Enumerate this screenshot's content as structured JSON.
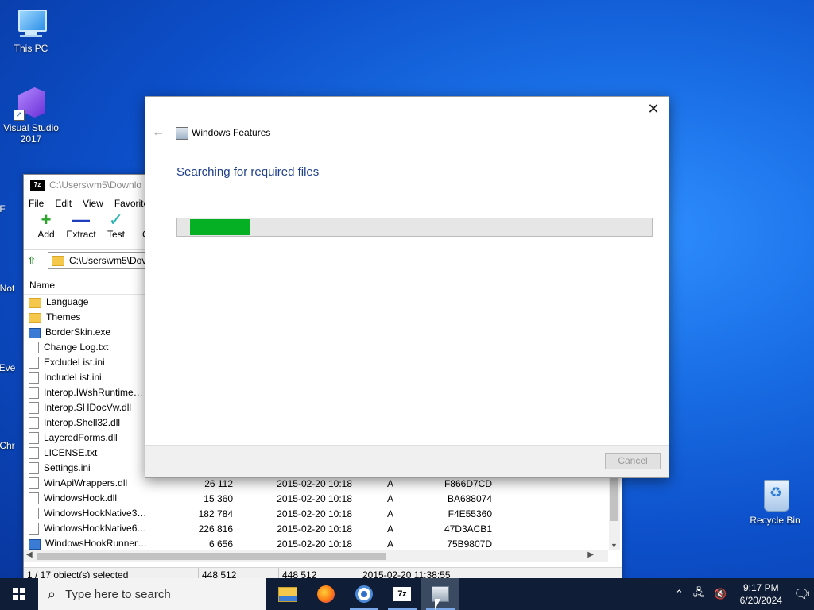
{
  "desktop": {
    "icons": [
      {
        "label": "This PC"
      },
      {
        "label": "Visual Studio 2017"
      },
      {
        "label": "Recycle Bin"
      }
    ],
    "partial_labels": [
      "F",
      "Not",
      "Eve",
      "Chr"
    ]
  },
  "zip_window": {
    "title": "C:\\Users\\vm5\\Downlo",
    "logo": "7z",
    "menu": [
      "File",
      "Edit",
      "View",
      "Favorite"
    ],
    "tools": [
      {
        "label": "Add",
        "icon": "+"
      },
      {
        "label": "Extract",
        "icon": "—"
      },
      {
        "label": "Test",
        "icon": "✓"
      },
      {
        "label": "Cop",
        "icon": "→"
      }
    ],
    "address": "C:\\Users\\vm5\\Dov",
    "column_name": "Name",
    "rows": [
      {
        "name": "Language",
        "type": "folder",
        "size": "",
        "modified": "",
        "attr": "",
        "crc": ""
      },
      {
        "name": "Themes",
        "type": "folder",
        "size": "",
        "modified": "",
        "attr": "",
        "crc": ""
      },
      {
        "name": "BorderSkin.exe",
        "type": "exe",
        "size": "",
        "modified": "",
        "attr": "",
        "crc": ""
      },
      {
        "name": "Change Log.txt",
        "type": "file",
        "size": "",
        "modified": "",
        "attr": "",
        "crc": ""
      },
      {
        "name": "ExcludeList.ini",
        "type": "file",
        "size": "",
        "modified": "",
        "attr": "",
        "crc": ""
      },
      {
        "name": "IncludeList.ini",
        "type": "file",
        "size": "",
        "modified": "",
        "attr": "",
        "crc": ""
      },
      {
        "name": "Interop.IWshRuntimeLi...",
        "type": "file",
        "size": "",
        "modified": "",
        "attr": "",
        "crc": ""
      },
      {
        "name": "Interop.SHDocVw.dll",
        "type": "file",
        "size": "",
        "modified": "",
        "attr": "",
        "crc": ""
      },
      {
        "name": "Interop.Shell32.dll",
        "type": "file",
        "size": "",
        "modified": "",
        "attr": "",
        "crc": ""
      },
      {
        "name": "LayeredForms.dll",
        "type": "file",
        "size": "",
        "modified": "",
        "attr": "",
        "crc": ""
      },
      {
        "name": "LICENSE.txt",
        "type": "file",
        "size": "",
        "modified": "",
        "attr": "",
        "crc": ""
      },
      {
        "name": "Settings.ini",
        "type": "file",
        "size": "",
        "modified": "",
        "attr": "",
        "crc": ""
      },
      {
        "name": "WinApiWrappers.dll",
        "type": "file",
        "size": "26 112",
        "modified": "2015-02-20 10:18",
        "attr": "A",
        "crc": "F866D7CD"
      },
      {
        "name": "WindowsHook.dll",
        "type": "file",
        "size": "15 360",
        "modified": "2015-02-20 10:18",
        "attr": "A",
        "crc": "BA688074"
      },
      {
        "name": "WindowsHookNative32...",
        "type": "file",
        "size": "182 784",
        "modified": "2015-02-20 10:18",
        "attr": "A",
        "crc": "F4E55360"
      },
      {
        "name": "WindowsHookNative64...",
        "type": "file",
        "size": "226 816",
        "modified": "2015-02-20 10:18",
        "attr": "A",
        "crc": "47D3ACB1"
      },
      {
        "name": "WindowsHookRunner3...",
        "type": "exe",
        "size": "6 656",
        "modified": "2015-02-20 10:18",
        "attr": "A",
        "crc": "75B9807D"
      }
    ],
    "status": {
      "selected": "1 / 17 object(s) selected",
      "size": "448 512",
      "packed": "448 512",
      "modified": "2015-02-20 11:38:55"
    }
  },
  "dialog": {
    "title": "Windows Features",
    "heading": "Searching for required files",
    "progress_fraction": 0.215,
    "cancel_label": "Cancel"
  },
  "taskbar": {
    "search_placeholder": "Type here to search",
    "zip_label": "7z",
    "time": "9:17 PM",
    "date": "6/20/2024",
    "notification_count": "1"
  }
}
